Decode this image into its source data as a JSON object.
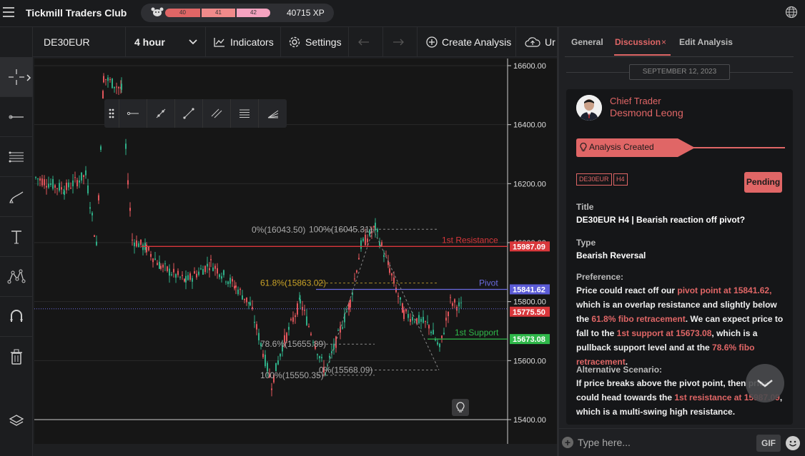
{
  "app": {
    "title": "Tickmill Traders Club",
    "xp_levels": [
      "40",
      "41",
      "42"
    ],
    "xp_total": "40715 XP"
  },
  "toolbar": {
    "symbol": "DE30EUR",
    "timeframe": "4 hour",
    "indicators": "Indicators",
    "settings": "Settings",
    "create_analysis": "Create Analysis",
    "upload_partial": "Ur"
  },
  "chart": {
    "price_axis": [
      "16600.00",
      "16400.00",
      "16200.00",
      "16000.00",
      "15800.00",
      "15600.00",
      "15400.00"
    ],
    "price_min": 15400,
    "price_max": 16600,
    "markers": [
      {
        "label": "15987.09",
        "color": "#d9373b"
      },
      {
        "label": "15841.62",
        "color": "#5b5bd6"
      },
      {
        "label": "15775.50",
        "color": "#d9373b"
      },
      {
        "label": "15673.08",
        "color": "#2fb84a"
      }
    ],
    "levels": [
      {
        "name": "1st Resistance",
        "color": "#d9373b"
      },
      {
        "name": "Pivot",
        "color": "#6b6be0"
      },
      {
        "name": "1st Support",
        "color": "#2fb84a"
      }
    ],
    "fibs_left": [
      "0%(16043.50)",
      "61.8%(15863.02)",
      "78.6%(15655.89)",
      "100%(15550.35)"
    ],
    "fibs_right": [
      "100%(16045.31)",
      "0%(15568.09)"
    ]
  },
  "panel": {
    "tabs": [
      "General",
      "Discussion",
      "Edit Analysis"
    ],
    "tab_close": "×",
    "date": "SEPTEMBER 12, 2023",
    "author_role": "Chief Trader",
    "author_name": "Desmond Leong",
    "event": "Analysis Created",
    "tags": [
      "DE30EUR",
      "H4"
    ],
    "status": "Pending",
    "title_label": "Title",
    "title_value": "DE30EUR H4 | Bearish reaction off pivot?",
    "type_label": "Type",
    "type_value": "Bearish Reversal",
    "pref_label": "Preference:",
    "pref_1": "Price could react off our ",
    "pref_hl1": "pivot point at 15841.62,",
    "pref_2": " which is an overlap resistance and slightly below the ",
    "pref_hl2": "61.8% fibo retracement",
    "pref_3": ". We can expect price to fall to the ",
    "pref_hl3": "1st support at 15673.08",
    "pref_4": ", which is a pullback support level and at the ",
    "pref_hl4": "78.6% fibo retracement",
    "pref_5": ".",
    "alt_label": "Alternative Scenario:",
    "alt_1": "If price breaks above the pivot point, then price could head towards the ",
    "alt_hl1": "1st resistance at 15987.09",
    "alt_2": ", which is a multi-swing high resistance.",
    "composer_placeholder": "Type here...",
    "gif": "GIF"
  }
}
